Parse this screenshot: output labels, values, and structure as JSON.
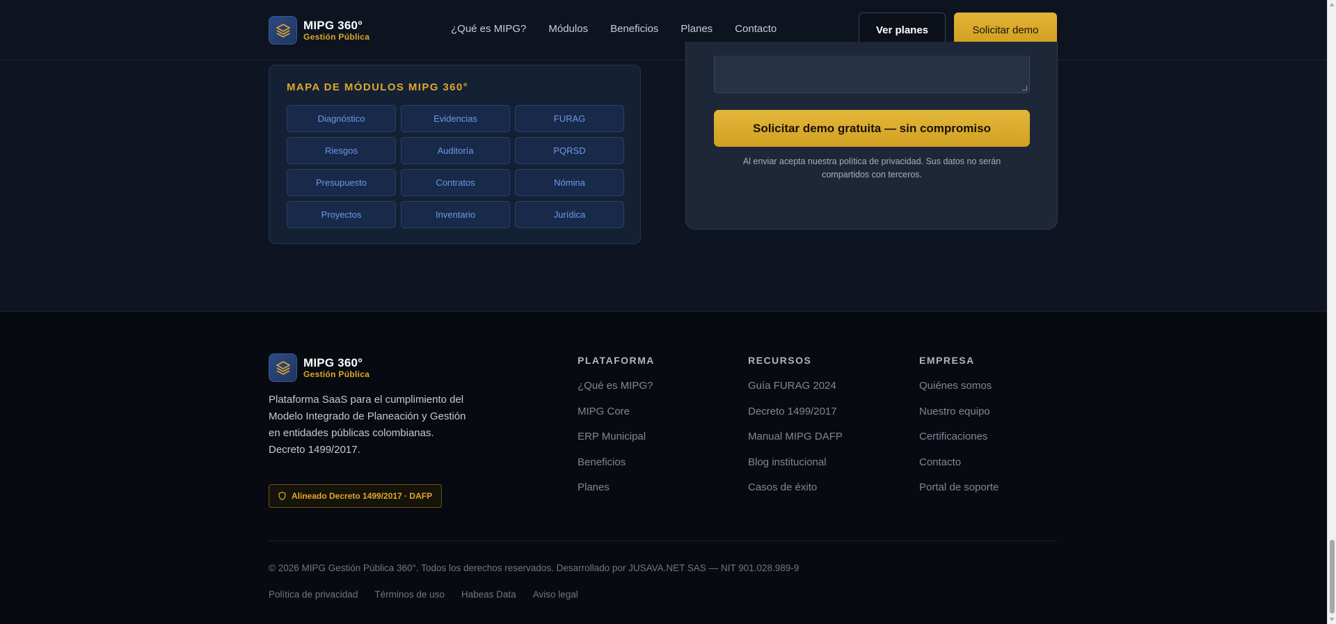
{
  "brand": {
    "title": "MIPG 360°",
    "subtitle": "Gestión Pública"
  },
  "nav": {
    "items": [
      {
        "label": "¿Qué es MIPG?"
      },
      {
        "label": "Módulos"
      },
      {
        "label": "Beneficios"
      },
      {
        "label": "Planes"
      },
      {
        "label": "Contacto"
      }
    ],
    "ver_planes": "Ver planes",
    "solicitar_demo": "Solicitar demo"
  },
  "modules": {
    "title": "MAPA DE MÓDULOS MIPG 360°",
    "items": [
      "Diagnóstico",
      "Evidencias",
      "FURAG",
      "Riesgos",
      "Auditoría",
      "PQRSD",
      "Presupuesto",
      "Contratos",
      "Nómina",
      "Proyectos",
      "Inventario",
      "Jurídica"
    ]
  },
  "form": {
    "submit_label": "Solicitar demo gratuita — sin compromiso",
    "privacy_line1": "Al enviar acepta nuestra política de privacidad. Sus datos no serán",
    "privacy_line2": "compartidos con terceros."
  },
  "footer": {
    "description": "Plataforma SaaS para el cumplimiento del Modelo Integrado de Planeación y Gestión en entidades públicas colombianas. Decreto 1499/2017.",
    "badge": "Alineado Decreto 1499/2017 · DAFP",
    "columns": [
      {
        "title": "PLATAFORMA",
        "links": [
          "¿Qué es MIPG?",
          "MIPG Core",
          "ERP Municipal",
          "Beneficios",
          "Planes"
        ]
      },
      {
        "title": "RECURSOS",
        "links": [
          "Guía FURAG 2024",
          "Decreto 1499/2017",
          "Manual MIPG DAFP",
          "Blog institucional",
          "Casos de éxito"
        ]
      },
      {
        "title": "EMPRESA",
        "links": [
          "Quiénes somos",
          "Nuestro equipo",
          "Certificaciones",
          "Contacto",
          "Portal de soporte"
        ]
      }
    ],
    "copyright": "© 2026 MIPG Gestión Pública 360°. Todos los derechos reservados. Desarrollado por JUSAVA.NET SAS — NIT 901.028.989-9",
    "legal": [
      "Política de privacidad",
      "Términos de uso",
      "Habeas Data",
      "Aviso legal"
    ]
  },
  "colors": {
    "accent_gold": "#e0a82a",
    "module_blue": "#6d9ae8",
    "background": "#0e1421",
    "footer_bg": "#070a10"
  }
}
